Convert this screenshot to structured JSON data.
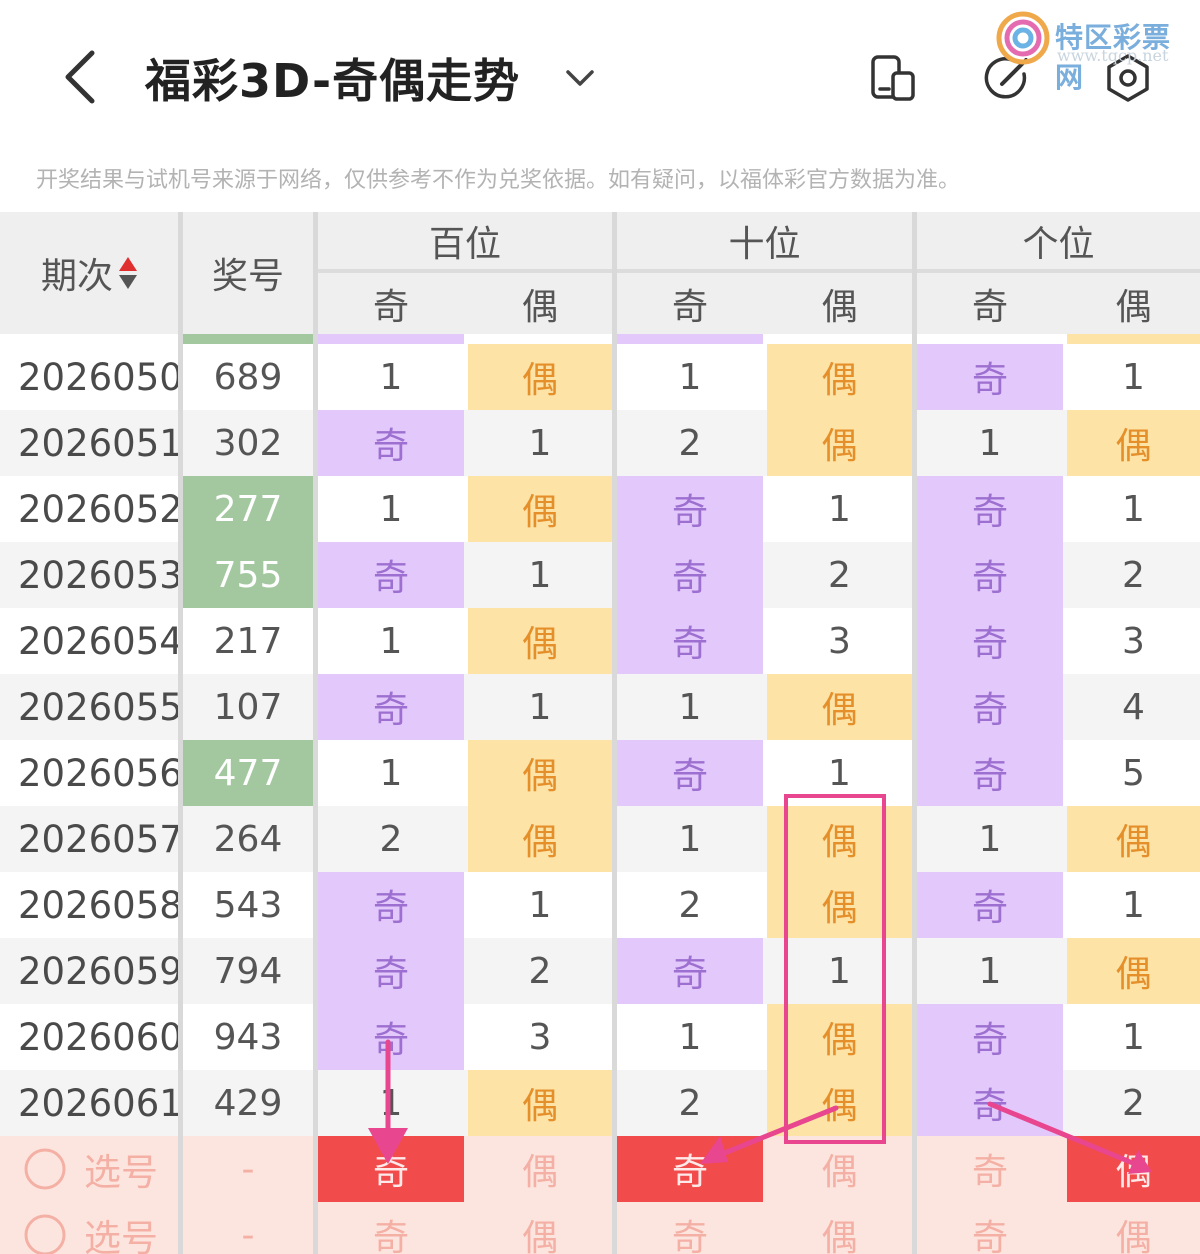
{
  "header": {
    "title": "福彩3D-奇偶走势",
    "icons": [
      "back-arrow-icon",
      "chevron-down-icon",
      "layout-switch-icon",
      "pen-icon",
      "settings-icon"
    ]
  },
  "watermark": {
    "name": "特区彩票网",
    "url": "www.tqcp.net"
  },
  "notice": "开奖结果与试机号来源于网络，仅供参考不作为兑奖依据。如有疑问，以福体彩官方数据为准。",
  "table": {
    "headers": {
      "period": "期次",
      "number": "奖号",
      "groups": [
        "百位",
        "十位",
        "个位"
      ],
      "odd": "奇",
      "even": "偶"
    },
    "rows": [
      {
        "period": "2026050",
        "number": "689",
        "green": false,
        "cells": [
          {
            "t": "1",
            "s": ""
          },
          {
            "t": "偶",
            "s": "even"
          },
          {
            "t": "1",
            "s": ""
          },
          {
            "t": "偶",
            "s": "even"
          },
          {
            "t": "奇",
            "s": "odd"
          },
          {
            "t": "1",
            "s": ""
          }
        ]
      },
      {
        "period": "2026051",
        "number": "302",
        "green": false,
        "cells": [
          {
            "t": "奇",
            "s": "odd"
          },
          {
            "t": "1",
            "s": ""
          },
          {
            "t": "2",
            "s": ""
          },
          {
            "t": "偶",
            "s": "even"
          },
          {
            "t": "1",
            "s": ""
          },
          {
            "t": "偶",
            "s": "even"
          }
        ]
      },
      {
        "period": "2026052",
        "number": "277",
        "green": true,
        "cells": [
          {
            "t": "1",
            "s": ""
          },
          {
            "t": "偶",
            "s": "even"
          },
          {
            "t": "奇",
            "s": "odd"
          },
          {
            "t": "1",
            "s": ""
          },
          {
            "t": "奇",
            "s": "odd"
          },
          {
            "t": "1",
            "s": ""
          }
        ]
      },
      {
        "period": "2026053",
        "number": "755",
        "green": true,
        "cells": [
          {
            "t": "奇",
            "s": "odd"
          },
          {
            "t": "1",
            "s": ""
          },
          {
            "t": "奇",
            "s": "odd"
          },
          {
            "t": "2",
            "s": ""
          },
          {
            "t": "奇",
            "s": "odd"
          },
          {
            "t": "2",
            "s": ""
          }
        ]
      },
      {
        "period": "2026054",
        "number": "217",
        "green": false,
        "cells": [
          {
            "t": "1",
            "s": ""
          },
          {
            "t": "偶",
            "s": "even"
          },
          {
            "t": "奇",
            "s": "odd"
          },
          {
            "t": "3",
            "s": ""
          },
          {
            "t": "奇",
            "s": "odd"
          },
          {
            "t": "3",
            "s": ""
          }
        ]
      },
      {
        "period": "2026055",
        "number": "107",
        "green": false,
        "cells": [
          {
            "t": "奇",
            "s": "odd"
          },
          {
            "t": "1",
            "s": ""
          },
          {
            "t": "1",
            "s": ""
          },
          {
            "t": "偶",
            "s": "even"
          },
          {
            "t": "奇",
            "s": "odd"
          },
          {
            "t": "4",
            "s": ""
          }
        ]
      },
      {
        "period": "2026056",
        "number": "477",
        "green": true,
        "cells": [
          {
            "t": "1",
            "s": ""
          },
          {
            "t": "偶",
            "s": "even"
          },
          {
            "t": "奇",
            "s": "odd"
          },
          {
            "t": "1",
            "s": ""
          },
          {
            "t": "奇",
            "s": "odd"
          },
          {
            "t": "5",
            "s": ""
          }
        ]
      },
      {
        "period": "2026057",
        "number": "264",
        "green": false,
        "cells": [
          {
            "t": "2",
            "s": ""
          },
          {
            "t": "偶",
            "s": "even"
          },
          {
            "t": "1",
            "s": ""
          },
          {
            "t": "偶",
            "s": "even"
          },
          {
            "t": "1",
            "s": ""
          },
          {
            "t": "偶",
            "s": "even"
          }
        ]
      },
      {
        "period": "2026058",
        "number": "543",
        "green": false,
        "cells": [
          {
            "t": "奇",
            "s": "odd"
          },
          {
            "t": "1",
            "s": ""
          },
          {
            "t": "2",
            "s": ""
          },
          {
            "t": "偶",
            "s": "even"
          },
          {
            "t": "奇",
            "s": "odd"
          },
          {
            "t": "1",
            "s": ""
          }
        ]
      },
      {
        "period": "2026059",
        "number": "794",
        "green": false,
        "cells": [
          {
            "t": "奇",
            "s": "odd"
          },
          {
            "t": "2",
            "s": ""
          },
          {
            "t": "奇",
            "s": "odd"
          },
          {
            "t": "1",
            "s": ""
          },
          {
            "t": "1",
            "s": ""
          },
          {
            "t": "偶",
            "s": "even"
          }
        ]
      },
      {
        "period": "2026060",
        "number": "943",
        "green": false,
        "cells": [
          {
            "t": "奇",
            "s": "odd"
          },
          {
            "t": "3",
            "s": ""
          },
          {
            "t": "1",
            "s": ""
          },
          {
            "t": "偶",
            "s": "even"
          },
          {
            "t": "奇",
            "s": "odd"
          },
          {
            "t": "1",
            "s": ""
          }
        ]
      },
      {
        "period": "2026061",
        "number": "429",
        "green": false,
        "cells": [
          {
            "t": "1",
            "s": ""
          },
          {
            "t": "偶",
            "s": "even"
          },
          {
            "t": "2",
            "s": ""
          },
          {
            "t": "偶",
            "s": "even"
          },
          {
            "t": "奇",
            "s": "odd"
          },
          {
            "t": "2",
            "s": ""
          }
        ]
      }
    ],
    "pick_rows": [
      {
        "label": "选号",
        "number": "-",
        "cells": [
          {
            "t": "奇",
            "s": "hl-red"
          },
          {
            "t": "偶",
            "s": "pick"
          },
          {
            "t": "奇",
            "s": "hl-red"
          },
          {
            "t": "偶",
            "s": "pick"
          },
          {
            "t": "奇",
            "s": "pick"
          },
          {
            "t": "偶",
            "s": "hl-red"
          }
        ]
      },
      {
        "label": "选号",
        "number": "-",
        "cells": [
          {
            "t": "奇",
            "s": "pick"
          },
          {
            "t": "偶",
            "s": "pick"
          },
          {
            "t": "奇",
            "s": "pick"
          },
          {
            "t": "偶",
            "s": "pick"
          },
          {
            "t": "奇",
            "s": "pick"
          },
          {
            "t": "偶",
            "s": "pick"
          }
        ]
      }
    ]
  },
  "colors": {
    "odd_bg": "#e3c9fb",
    "even_bg": "#fde3a6",
    "hot_number": "#a3c8a0",
    "selected_red": "#f24b4b",
    "annotation_pink": "#e8468f"
  }
}
